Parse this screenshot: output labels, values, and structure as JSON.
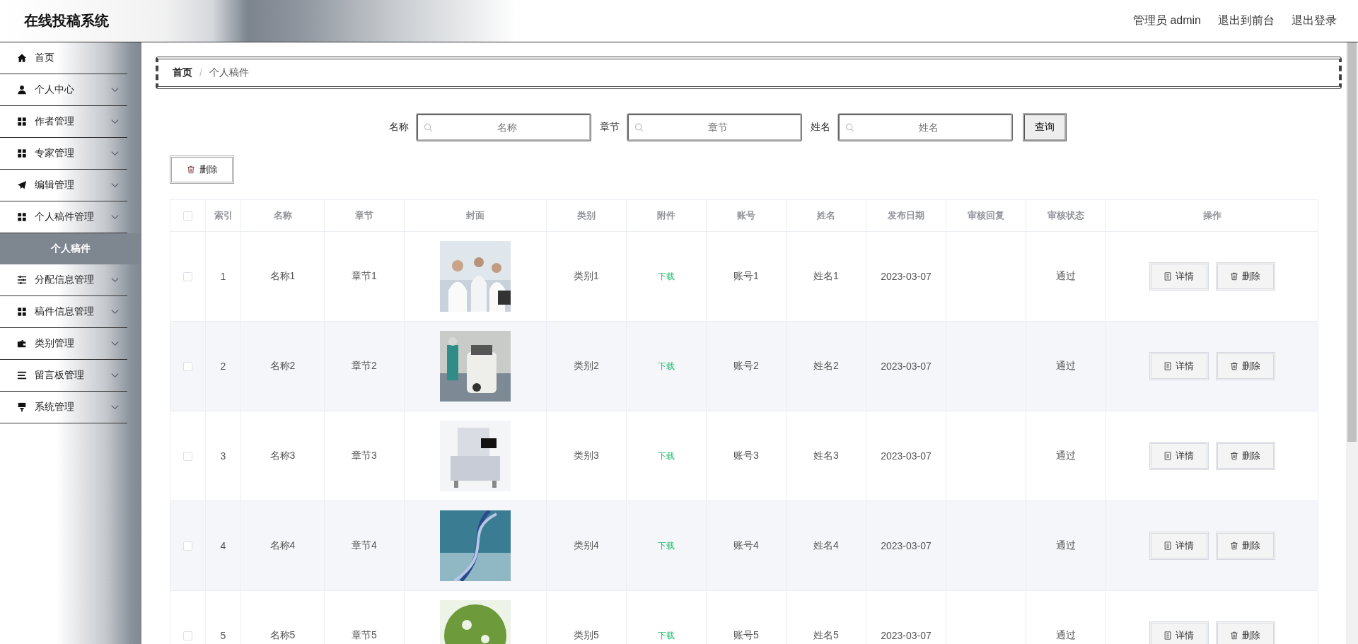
{
  "header": {
    "title": "在线投稿系统",
    "user": "管理员 admin",
    "links": [
      "退出到前台",
      "退出登录"
    ]
  },
  "sidebar": {
    "items": [
      {
        "label": "首页"
      },
      {
        "label": "个人中心",
        "has_arrow": true
      },
      {
        "label": "作者管理",
        "has_arrow": true
      },
      {
        "label": "专家管理",
        "has_arrow": true
      },
      {
        "label": "编辑管理",
        "has_arrow": true
      },
      {
        "label": "个人稿件管理",
        "expanded": true,
        "has_arrow": true,
        "children": [
          {
            "label": "个人稿件",
            "selected": true
          }
        ]
      },
      {
        "label": "分配信息管理",
        "has_arrow": true
      },
      {
        "label": "稿件信息管理",
        "has_arrow": true
      },
      {
        "label": "类别管理",
        "has_arrow": true
      },
      {
        "label": "留言板管理",
        "has_arrow": true
      },
      {
        "label": "系统管理",
        "has_arrow": true
      }
    ]
  },
  "breadcrumb": {
    "items": [
      "首页",
      "个人稿件"
    ],
    "separator": "/"
  },
  "search": {
    "fields": [
      {
        "label": "名称",
        "placeholder": "名称"
      },
      {
        "label": "章节",
        "placeholder": "章节"
      },
      {
        "label": "姓名",
        "placeholder": "姓名"
      }
    ],
    "button": "查询"
  },
  "toolbar": {
    "delete_button": "删除"
  },
  "table": {
    "columns": [
      "索引",
      "名称",
      "章节",
      "封面",
      "类别",
      "附件",
      "账号",
      "姓名",
      "发布日期",
      "审核回复",
      "审核状态",
      "操作"
    ],
    "header_checked": false,
    "rows": [
      {
        "checked": false,
        "index": "1",
        "name": "名称1",
        "chapter": "章节1",
        "cover": {
          "kind": "picture"
        },
        "category": "类别1",
        "attachment": "下载",
        "account": "账号1",
        "person": "姓名1",
        "date": "2023-03-07",
        "status": "通过",
        "actions": [
          "详情",
          "删除"
        ]
      },
      {
        "checked": false,
        "index": "2",
        "name": "名称2",
        "chapter": "章节2",
        "cover": {
          "kind": "picture"
        },
        "category": "类别2",
        "attachment": "下载",
        "account": "账号2",
        "person": "姓名2",
        "date": "2023-03-07",
        "status": "通过",
        "actions": [
          "详情",
          "删除"
        ]
      },
      {
        "checked": false,
        "index": "3",
        "name": "名称3",
        "chapter": "章节3",
        "cover": {
          "kind": "picture"
        },
        "category": "类别3",
        "attachment": "下载",
        "account": "账号3",
        "person": "姓名3",
        "date": "2023-03-07",
        "status": "通过",
        "actions": [
          "详情",
          "删除"
        ]
      },
      {
        "checked": false,
        "index": "4",
        "name": "名称4",
        "chapter": "章节4",
        "cover": {
          "kind": "picture"
        },
        "category": "类别4",
        "attachment": "下载",
        "account": "账号4",
        "person": "姓名4",
        "date": "2023-03-07",
        "status": "通过",
        "actions": [
          "详情",
          "删除"
        ]
      },
      {
        "checked": false,
        "index": "5",
        "name": "名称5",
        "chapter": "章节5",
        "cover": {
          "kind": "picture"
        },
        "category": "类别5",
        "attachment": "下载",
        "account": "账号5",
        "person": "姓名5",
        "date": "2023-03-07",
        "status": "通过",
        "actions": [
          "详情",
          "删除"
        ]
      }
    ]
  }
}
